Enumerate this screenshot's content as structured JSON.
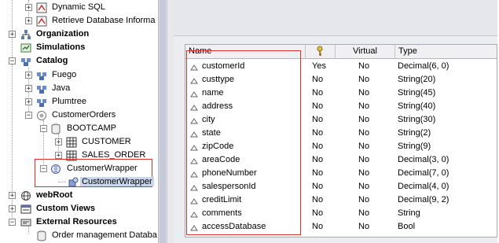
{
  "tree": {
    "items": [
      {
        "label": "Dynamic SQL"
      },
      {
        "label": "Retrieve Database Informa"
      },
      {
        "label": "Organization"
      },
      {
        "label": "Simulations"
      },
      {
        "label": "Catalog"
      },
      {
        "label": "Fuego"
      },
      {
        "label": "Java"
      },
      {
        "label": "Plumtree"
      },
      {
        "label": "CustomerOrders"
      },
      {
        "label": "BOOTCAMP"
      },
      {
        "label": "CUSTOMER"
      },
      {
        "label": "SALES_ORDER"
      },
      {
        "label": "CustomerWrapper"
      },
      {
        "label": "CustomerWrapper"
      },
      {
        "label": "webRoot"
      },
      {
        "label": "Custom Views"
      },
      {
        "label": "External Resources"
      },
      {
        "label": "Order management Databa"
      }
    ],
    "expand_symbols": {
      "plus": "+",
      "minus": "−"
    }
  },
  "table": {
    "headers": {
      "name": "Name",
      "key_icon": "key-icon",
      "virtual": "Virtual",
      "type": "Type"
    },
    "rows": [
      {
        "name": "customerId",
        "key": "Yes",
        "virtual": "No",
        "type": "Decimal(6, 0)"
      },
      {
        "name": "custtype",
        "key": "No",
        "virtual": "No",
        "type": "String(20)"
      },
      {
        "name": "name",
        "key": "No",
        "virtual": "No",
        "type": "String(45)"
      },
      {
        "name": "address",
        "key": "No",
        "virtual": "No",
        "type": "String(40)"
      },
      {
        "name": "city",
        "key": "No",
        "virtual": "No",
        "type": "String(30)"
      },
      {
        "name": "state",
        "key": "No",
        "virtual": "No",
        "type": "String(2)"
      },
      {
        "name": "zipCode",
        "key": "No",
        "virtual": "No",
        "type": "String(9)"
      },
      {
        "name": "areaCode",
        "key": "No",
        "virtual": "No",
        "type": "Decimal(3, 0)"
      },
      {
        "name": "phoneNumber",
        "key": "No",
        "virtual": "No",
        "type": "Decimal(7, 0)"
      },
      {
        "name": "salespersonId",
        "key": "No",
        "virtual": "No",
        "type": "Decimal(4, 0)"
      },
      {
        "name": "creditLimit",
        "key": "No",
        "virtual": "No",
        "type": "Decimal(9, 2)"
      },
      {
        "name": "comments",
        "key": "No",
        "virtual": "No",
        "type": "String"
      },
      {
        "name": "accessDatabase",
        "key": "No",
        "virtual": "No",
        "type": "Bool"
      }
    ]
  },
  "colors": {
    "highlight": "#d9302c",
    "selection": "#c9d6ee",
    "header_bg": "#f0f0f3"
  }
}
